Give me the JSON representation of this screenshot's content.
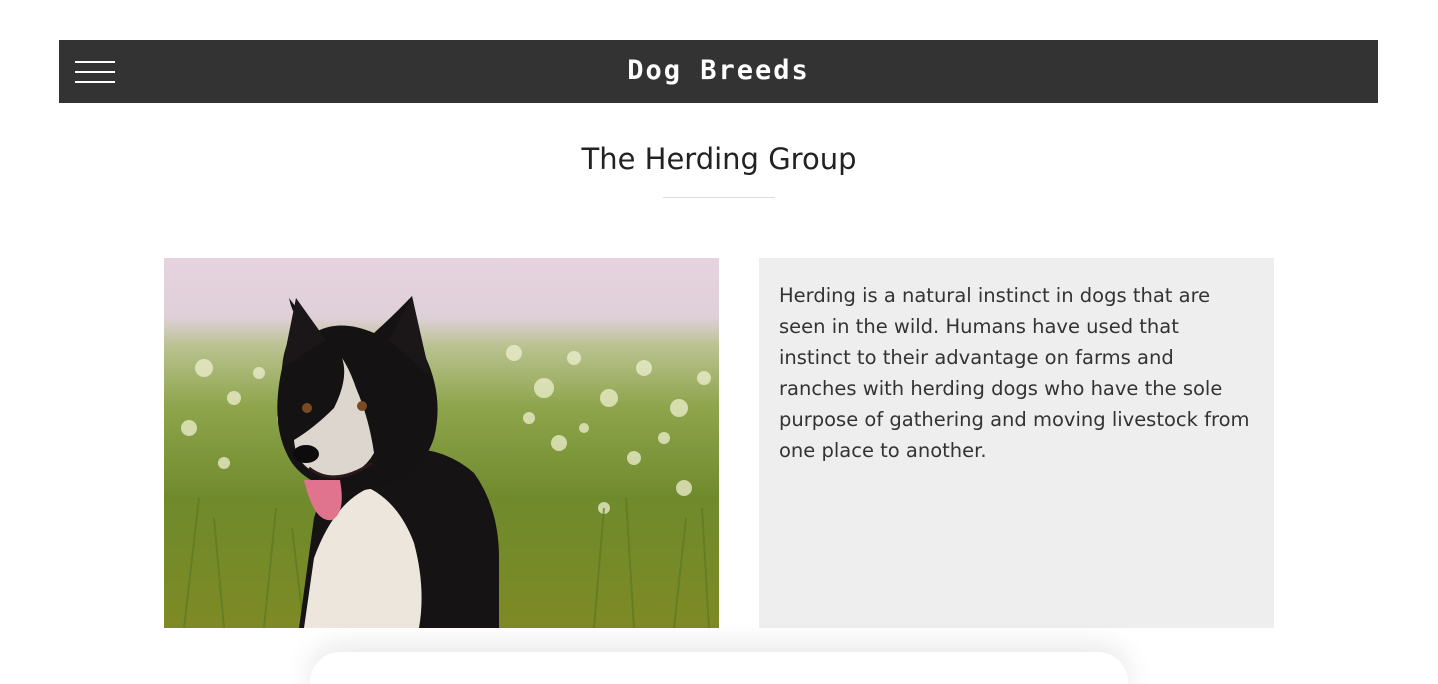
{
  "navbar": {
    "menu_icon": "hamburger-menu-icon",
    "title": "Dog Breeds",
    "background": "#333333"
  },
  "section": {
    "title": "The Herding Group",
    "image_subject": "black and white border collie in a grassy field",
    "description": "Herding is a natural instinct in dogs that are seen in the wild. Humans have used that instinct to their advantage on farms and ranches with herding dogs who have the sole purpose of gathering and moving livestock from one place to another.",
    "panel_color": "#eeeeee"
  }
}
